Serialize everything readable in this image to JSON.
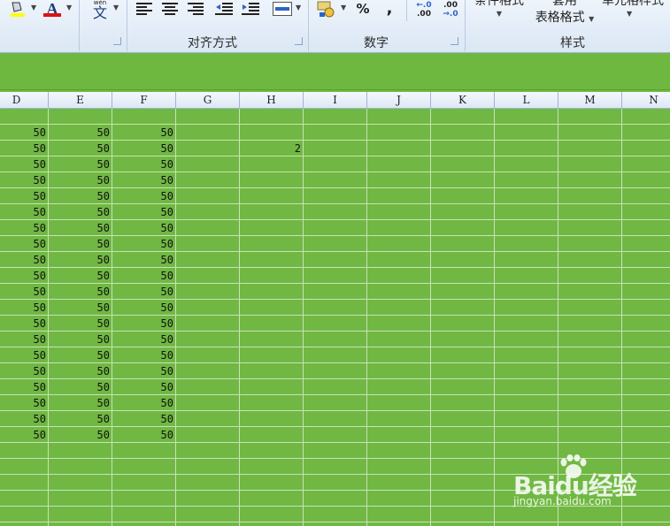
{
  "ribbon": {
    "groups": [
      {
        "label": "对齐方式"
      },
      {
        "label": "数字"
      },
      {
        "label": "样式"
      }
    ],
    "styles": {
      "conditional_format": "条件格式",
      "table_format_line1": "套用",
      "table_format_line2": "表格格式",
      "cell_styles": "单元格样式"
    },
    "number": {
      "percent": "%",
      "comma": ",",
      "increase_decimal_top": "←.0",
      "increase_decimal_bottom": ".00",
      "decrease_decimal_top": ".00",
      "decrease_decimal_bottom": "→.0"
    },
    "font": {
      "font_color_glyph": "A",
      "phonetic_glyph": "文",
      "phonetic_small": "wén"
    },
    "colors": {
      "highlight": "#ffff00",
      "font_color": "#e01010"
    }
  },
  "columns": [
    "D",
    "E",
    "F",
    "G",
    "H",
    "I",
    "J",
    "K",
    "L",
    "M",
    "N"
  ],
  "rows": [
    [
      "",
      "",
      "",
      "",
      ""
    ],
    [
      "50",
      "50",
      "50",
      "",
      ""
    ],
    [
      "50",
      "50",
      "50",
      "",
      "2"
    ],
    [
      "50",
      "50",
      "50",
      "",
      ""
    ],
    [
      "50",
      "50",
      "50",
      "",
      ""
    ],
    [
      "50",
      "50",
      "50",
      "",
      ""
    ],
    [
      "50",
      "50",
      "50",
      "",
      ""
    ],
    [
      "50",
      "50",
      "50",
      "",
      ""
    ],
    [
      "50",
      "50",
      "50",
      "",
      ""
    ],
    [
      "50",
      "50",
      "50",
      "",
      ""
    ],
    [
      "50",
      "50",
      "50",
      "",
      ""
    ],
    [
      "50",
      "50",
      "50",
      "",
      ""
    ],
    [
      "50",
      "50",
      "50",
      "",
      ""
    ],
    [
      "50",
      "50",
      "50",
      "",
      ""
    ],
    [
      "50",
      "50",
      "50",
      "",
      ""
    ],
    [
      "50",
      "50",
      "50",
      "",
      ""
    ],
    [
      "50",
      "50",
      "50",
      "",
      ""
    ],
    [
      "50",
      "50",
      "50",
      "",
      ""
    ],
    [
      "50",
      "50",
      "50",
      "",
      ""
    ],
    [
      "50",
      "50",
      "50",
      "",
      ""
    ],
    [
      "50",
      "50",
      "50",
      "",
      ""
    ]
  ],
  "watermark": {
    "brand": "Baidu经验",
    "url": "jingyan.baidu.com"
  },
  "sheet_colors": {
    "fill": "#70b843",
    "gridline": "#c9e2b5"
  }
}
